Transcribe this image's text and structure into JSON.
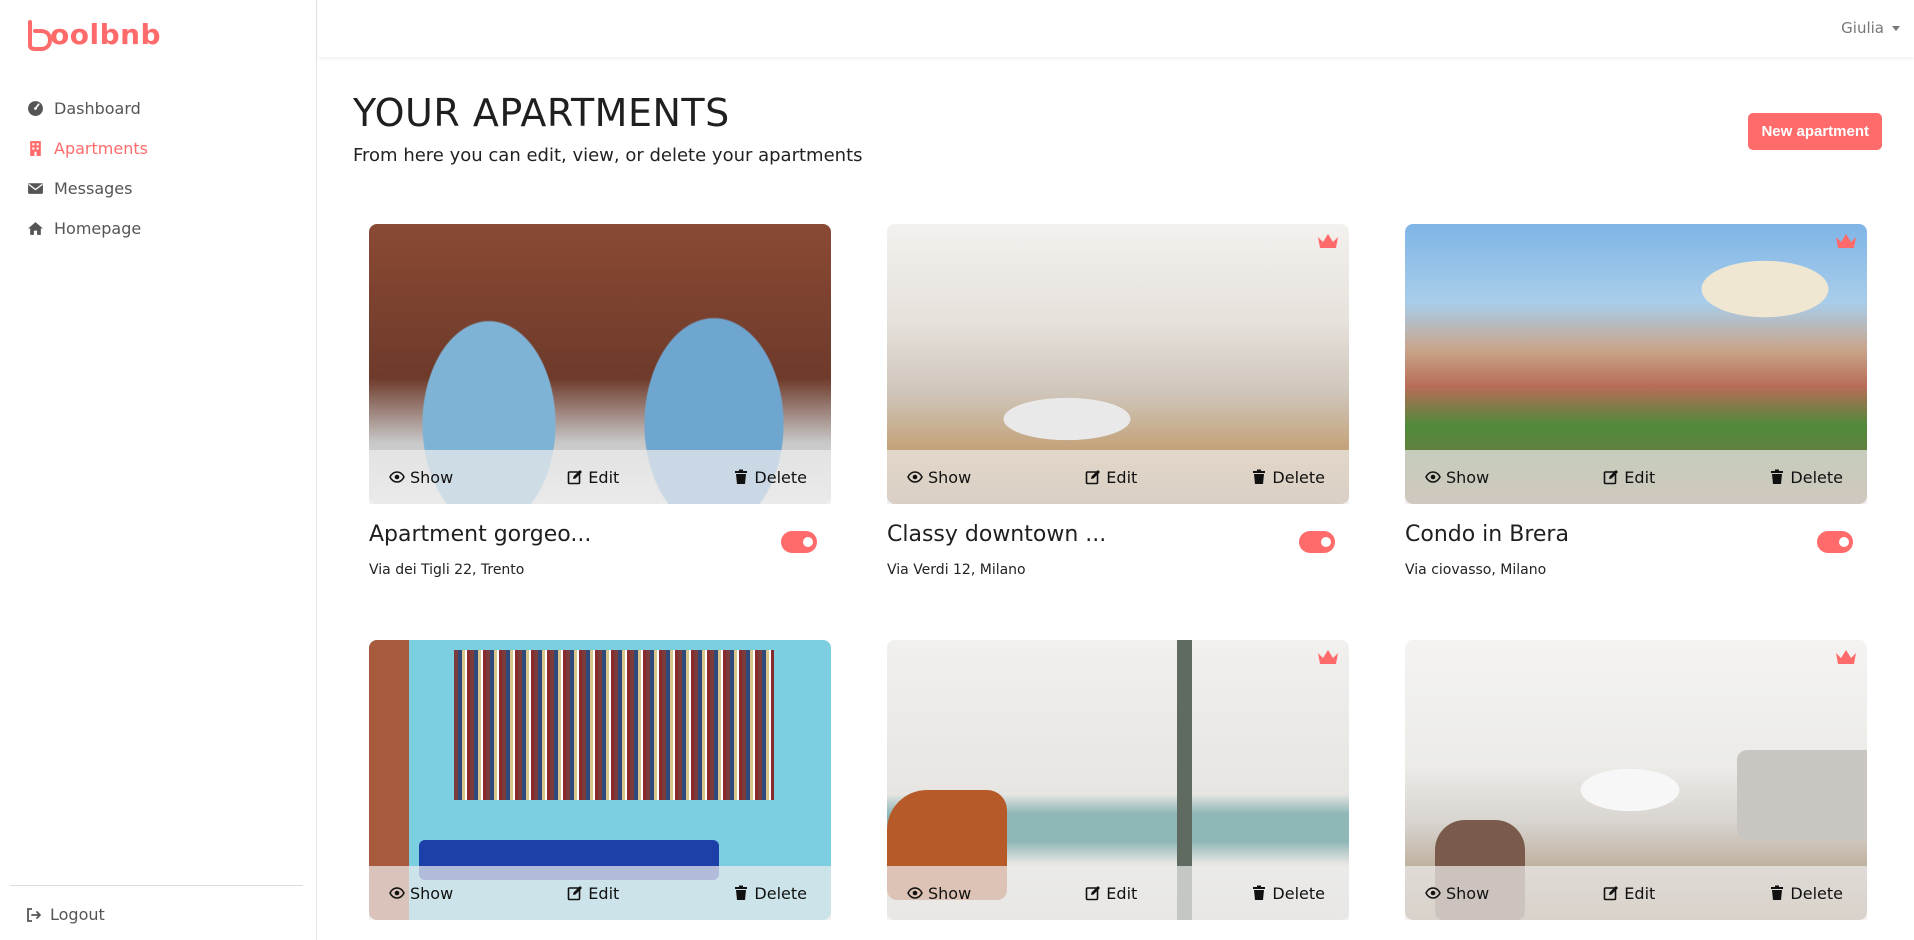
{
  "brand": {
    "name": "oolbnb",
    "color": "#ff6b6b"
  },
  "sidebar": {
    "items": [
      {
        "label": "Dashboard",
        "icon": "gauge-icon",
        "active": false
      },
      {
        "label": "Apartments",
        "icon": "building-icon",
        "active": true
      },
      {
        "label": "Messages",
        "icon": "envelope-icon",
        "active": false
      },
      {
        "label": "Homepage",
        "icon": "home-icon",
        "active": false
      }
    ],
    "logout": "Logout"
  },
  "topbar": {
    "user": "Giulia"
  },
  "page": {
    "title": "YOUR APARTMENTS",
    "subtitle": "From here you can edit, view, or delete your apartments",
    "new_button": "New apartment"
  },
  "actions": {
    "show": "Show",
    "edit": "Edit",
    "delete": "Delete"
  },
  "apartments": [
    {
      "title": "Apartment gorgeo...",
      "address": "Via dei Tigli 22, Trento",
      "sponsored": false,
      "visible": true
    },
    {
      "title": "Classy downtown ...",
      "address": "Via Verdi 12, Milano",
      "sponsored": true,
      "visible": true
    },
    {
      "title": "Condo in Brera",
      "address": "Via ciovasso, Milano",
      "sponsored": true,
      "visible": true
    },
    {
      "title": "",
      "address": "",
      "sponsored": false,
      "visible": true
    },
    {
      "title": "",
      "address": "",
      "sponsored": true,
      "visible": true
    },
    {
      "title": "",
      "address": "",
      "sponsored": true,
      "visible": true
    }
  ]
}
